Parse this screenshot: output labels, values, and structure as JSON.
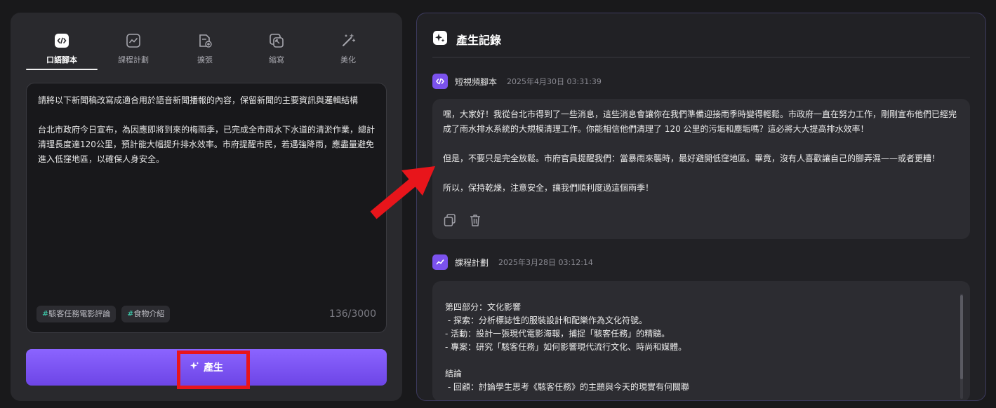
{
  "tabs": [
    {
      "label": "口語腳本",
      "icon": "code-icon",
      "active": true
    },
    {
      "label": "課程計劃",
      "icon": "chart-icon",
      "active": false
    },
    {
      "label": "擴張",
      "icon": "document-plus-icon",
      "active": false
    },
    {
      "label": "縮寫",
      "icon": "shrink-icon",
      "active": false
    },
    {
      "label": "美化",
      "icon": "magic-wand-icon",
      "active": false
    }
  ],
  "editor": {
    "text": "請將以下新聞稿改寫成適合用於語音新聞播報的內容，保留新聞的主要資訊與邏輯結構\n\n台北市政府今日宣布，為因應即將到來的梅雨季，已完成全市雨水下水道的清淤作業，總計清理長度達120公里，預計能大幅提升排水效率。市府提醒市民，若遇強降雨，應盡量避免進入低窪地區，以確保人身安全。",
    "tags": [
      {
        "hash": "#",
        "label": "駭客任務電影評論"
      },
      {
        "hash": "#",
        "label": "食物介紹"
      }
    ],
    "char_count": "136/3000"
  },
  "generate_button": {
    "label": "產生",
    "icon": "sparkle-icon"
  },
  "history": {
    "title": "產生記錄",
    "records": [
      {
        "type": "短視頻腳本",
        "date": "2025年4月30日 03:31:39",
        "text": "嘿，大家好！我從台北市得到了一些消息，這些消息會讓你在我們準備迎接雨季時變得輕鬆。市政府一直在努力工作，剛剛宣布他們已經完成了雨水排水系統的大規模清理工作。你能相信他們清理了 120 公里的污垢和塵垢嗎？這必將大大提高排水效率！\n\n但是，不要只是完全放鬆。市府官員提醒我們：當暴雨來襲時，最好避開低窪地區。畢竟，沒有人喜歡讓自己的腳弄濕——或者更糟！\n\n所以，保持乾燥，注意安全，讓我們順利度過這個雨季！"
      },
      {
        "type": "課程計劃",
        "date": "2025年3月28日 03:12:14",
        "text": "第四部分：文化影響\n - 探索：分析標誌性的服裝設計和配樂作為文化符號。\n- 活動：設計一張現代電影海報，捕捉「駭客任務」的精髓。\n- 專案：研究「駭客任務」如何影響現代流行文化、時尚和媒體。\n\n結論\n - 回顧：討論學生思考《駭客任務》的主題與今天的現實有何關聯"
      }
    ]
  },
  "colors": {
    "accent": "#7b52ee",
    "tag_hash": "#3ed0b0",
    "highlight": "#e8151b"
  }
}
